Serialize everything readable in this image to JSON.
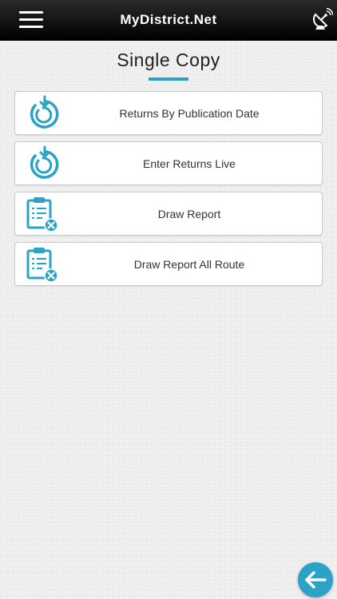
{
  "header": {
    "title": "MyDistrict.Net",
    "menu_icon": "hamburger-icon",
    "right_icon": "satellite-dish-icon"
  },
  "page": {
    "title": "Single Copy",
    "accent_color": "#2aa3c6"
  },
  "menu": {
    "items": [
      {
        "label": "Returns By Publication Date",
        "icon": "returns-arrow-icon"
      },
      {
        "label": "Enter Returns Live",
        "icon": "returns-arrow-icon"
      },
      {
        "label": "Draw Report",
        "icon": "clipboard-remove-icon"
      },
      {
        "label": "Draw Report All Route",
        "icon": "clipboard-remove-icon"
      }
    ]
  },
  "footer": {
    "back_icon": "back-arrow-icon"
  }
}
